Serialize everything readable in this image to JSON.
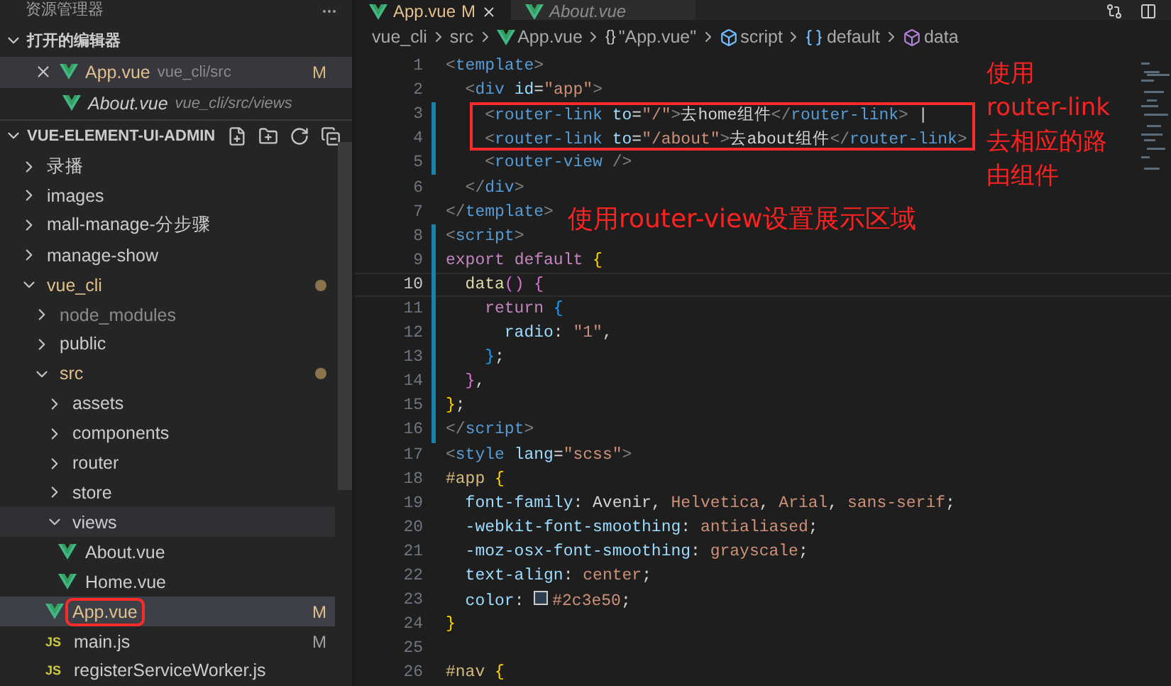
{
  "sidebar": {
    "title": "资源管理器",
    "open_editors": {
      "title": "打开的编辑器",
      "items": [
        {
          "label": "App.vue",
          "path": "vue_cli/src",
          "status": "M",
          "selected": true,
          "preview": false
        },
        {
          "label": "About.vue",
          "path": "vue_cli/src/views",
          "selected": false,
          "preview": true
        }
      ]
    },
    "project": {
      "title": "VUE-ELEMENT-UI-ADMIN",
      "tree": [
        {
          "label": "录播",
          "kind": "folder",
          "expanded": false,
          "selected": false,
          "modified": false
        },
        {
          "label": "images",
          "kind": "folder",
          "expanded": false,
          "selected": false,
          "modified": false
        },
        {
          "label": "mall-manage-分步骤",
          "kind": "folder",
          "expanded": false,
          "selected": false,
          "modified": false
        },
        {
          "label": "manage-show",
          "kind": "folder",
          "expanded": false,
          "selected": false,
          "modified": false
        },
        {
          "label": "vue_cli",
          "kind": "folder",
          "expanded": true,
          "selected": false,
          "modified": true,
          "children": [
            {
              "label": "node_modules",
              "kind": "folder",
              "expanded": false,
              "selected": false,
              "modified": false,
              "ignored": true
            },
            {
              "label": "public",
              "kind": "folder",
              "expanded": false,
              "selected": false,
              "modified": false
            },
            {
              "label": "src",
              "kind": "folder",
              "expanded": true,
              "selected": false,
              "modified": true,
              "children": [
                {
                  "label": "assets",
                  "kind": "folder",
                  "expanded": false,
                  "selected": false,
                  "modified": false
                },
                {
                  "label": "components",
                  "kind": "folder",
                  "expanded": false,
                  "selected": false,
                  "modified": false
                },
                {
                  "label": "router",
                  "kind": "folder",
                  "expanded": false,
                  "selected": false,
                  "modified": false
                },
                {
                  "label": "store",
                  "kind": "folder",
                  "expanded": false,
                  "selected": false,
                  "modified": false
                },
                {
                  "label": "views",
                  "kind": "folder",
                  "expanded": true,
                  "selected": false,
                  "modified": false,
                  "hovered": true,
                  "children": [
                    {
                      "label": "About.vue",
                      "kind": "vue",
                      "selected": false,
                      "modified": false
                    },
                    {
                      "label": "Home.vue",
                      "kind": "vue",
                      "selected": false,
                      "modified": false
                    }
                  ]
                },
                {
                  "label": "App.vue",
                  "kind": "vue",
                  "selected": true,
                  "modified": true,
                  "status": "M",
                  "annotated": true
                },
                {
                  "label": "main.js",
                  "kind": "js",
                  "badge": "JS",
                  "selected": false,
                  "modified": false,
                  "status": "M"
                },
                {
                  "label": "registerServiceWorker.js",
                  "kind": "js",
                  "badge": "JS",
                  "selected": false,
                  "modified": false
                }
              ]
            }
          ]
        }
      ]
    }
  },
  "editor": {
    "tabs": [
      {
        "label": "App.vue",
        "status": "M",
        "selected": true,
        "preview": false
      },
      {
        "label": "About.vue",
        "selected": false,
        "preview": true
      }
    ],
    "breadcrumb": [
      {
        "text": "vue_cli",
        "kind": "folder"
      },
      {
        "text": "src",
        "kind": "folder"
      },
      {
        "text": "App.vue",
        "kind": "vue"
      },
      {
        "text": "\"App.vue\"",
        "kind": "object",
        "symbol": "{}"
      },
      {
        "text": "script",
        "kind": "module"
      },
      {
        "text": "default",
        "kind": "variable"
      },
      {
        "text": "data",
        "kind": "method"
      }
    ],
    "lines": [
      {
        "number": "1",
        "changed": false,
        "current": false,
        "tokens": [
          {
            "text": "<",
            "kind": "punct"
          },
          {
            "text": "template",
            "kind": "tag"
          },
          {
            "text": ">",
            "kind": "punct"
          }
        ]
      },
      {
        "number": "2",
        "changed": false,
        "current": false,
        "tokens": [
          {
            "text": "  <",
            "kind": "punct"
          },
          {
            "text": "div",
            "kind": "tag"
          },
          {
            "text": " id",
            "kind": "attr"
          },
          {
            "text": "=",
            "kind": "plain"
          },
          {
            "text": "\"app\"",
            "kind": "string"
          },
          {
            "text": ">",
            "kind": "punct"
          }
        ]
      },
      {
        "number": "3",
        "changed": true,
        "current": false,
        "boxed": true,
        "tokens": [
          {
            "text": "    <",
            "kind": "punct"
          },
          {
            "text": "router-link",
            "kind": "tag"
          },
          {
            "text": " to",
            "kind": "attr"
          },
          {
            "text": "=",
            "kind": "plain"
          },
          {
            "text": "\"/\"",
            "kind": "string"
          },
          {
            "text": ">",
            "kind": "punct"
          },
          {
            "text": "去home组件",
            "kind": "plain"
          },
          {
            "text": "</",
            "kind": "punct"
          },
          {
            "text": "router-link",
            "kind": "tag"
          },
          {
            "text": ">",
            "kind": "punct"
          },
          {
            "text": " |",
            "kind": "plain"
          }
        ]
      },
      {
        "number": "4",
        "changed": true,
        "current": false,
        "boxed": true,
        "tokens": [
          {
            "text": "    <",
            "kind": "punct"
          },
          {
            "text": "router-link",
            "kind": "tag"
          },
          {
            "text": " to",
            "kind": "attr"
          },
          {
            "text": "=",
            "kind": "plain"
          },
          {
            "text": "\"/about\"",
            "kind": "string"
          },
          {
            "text": ">",
            "kind": "punct"
          },
          {
            "text": "去about组件",
            "kind": "plain"
          },
          {
            "text": "</",
            "kind": "punct"
          },
          {
            "text": "router-link",
            "kind": "tag"
          },
          {
            "text": ">",
            "kind": "punct"
          }
        ]
      },
      {
        "number": "5",
        "changed": true,
        "current": false,
        "tokens": [
          {
            "text": "    <",
            "kind": "punct"
          },
          {
            "text": "router-view",
            "kind": "tag"
          },
          {
            "text": " />",
            "kind": "punct"
          }
        ]
      },
      {
        "number": "6",
        "changed": false,
        "current": false,
        "tokens": [
          {
            "text": "  </",
            "kind": "punct"
          },
          {
            "text": "div",
            "kind": "tag"
          },
          {
            "text": ">",
            "kind": "punct"
          }
        ]
      },
      {
        "number": "7",
        "changed": false,
        "current": false,
        "tokens": [
          {
            "text": "</",
            "kind": "punct"
          },
          {
            "text": "template",
            "kind": "tag"
          },
          {
            "text": ">",
            "kind": "punct"
          }
        ]
      },
      {
        "number": "8",
        "changed": true,
        "current": false,
        "tokens": [
          {
            "text": "<",
            "kind": "punct"
          },
          {
            "text": "script",
            "kind": "tag"
          },
          {
            "text": ">",
            "kind": "punct"
          }
        ]
      },
      {
        "number": "9",
        "changed": true,
        "current": false,
        "tokens": [
          {
            "text": "export",
            "kind": "keyword"
          },
          {
            "text": " default",
            "kind": "keyword"
          },
          {
            "text": " {",
            "kind": "brace1"
          }
        ]
      },
      {
        "number": "10",
        "changed": true,
        "current": true,
        "tokens": [
          {
            "text": "  data",
            "kind": "func"
          },
          {
            "text": "()",
            "kind": "brace2"
          },
          {
            "text": " {",
            "kind": "brace2"
          }
        ]
      },
      {
        "number": "11",
        "changed": true,
        "current": false,
        "tokens": [
          {
            "text": "    return",
            "kind": "keyword"
          },
          {
            "text": " {",
            "kind": "brace3"
          }
        ]
      },
      {
        "number": "12",
        "changed": true,
        "current": false,
        "tokens": [
          {
            "text": "      radio",
            "kind": "attr"
          },
          {
            "text": ": ",
            "kind": "plain"
          },
          {
            "text": "\"1\"",
            "kind": "string"
          },
          {
            "text": ",",
            "kind": "plain"
          }
        ]
      },
      {
        "number": "13",
        "changed": true,
        "current": false,
        "tokens": [
          {
            "text": "    }",
            "kind": "brace3"
          },
          {
            "text": ";",
            "kind": "plain"
          }
        ]
      },
      {
        "number": "14",
        "changed": true,
        "current": false,
        "tokens": [
          {
            "text": "  }",
            "kind": "brace2"
          },
          {
            "text": ",",
            "kind": "plain"
          }
        ]
      },
      {
        "number": "15",
        "changed": true,
        "current": false,
        "tokens": [
          {
            "text": "}",
            "kind": "brace1"
          },
          {
            "text": ";",
            "kind": "plain"
          }
        ]
      },
      {
        "number": "16",
        "changed": true,
        "current": false,
        "tokens": [
          {
            "text": "</",
            "kind": "punct"
          },
          {
            "text": "script",
            "kind": "tag"
          },
          {
            "text": ">",
            "kind": "punct"
          }
        ]
      },
      {
        "number": "17",
        "changed": false,
        "current": false,
        "tokens": [
          {
            "text": "<",
            "kind": "punct"
          },
          {
            "text": "style",
            "kind": "tag"
          },
          {
            "text": " lang",
            "kind": "attr"
          },
          {
            "text": "=",
            "kind": "plain"
          },
          {
            "text": "\"scss\"",
            "kind": "string"
          },
          {
            "text": ">",
            "kind": "punct"
          }
        ]
      },
      {
        "number": "18",
        "changed": false,
        "current": false,
        "tokens": [
          {
            "text": "#app",
            "kind": "selector"
          },
          {
            "text": " {",
            "kind": "brace1"
          }
        ]
      },
      {
        "number": "19",
        "changed": false,
        "current": false,
        "tokens": [
          {
            "text": "  font-family",
            "kind": "attr"
          },
          {
            "text": ": Avenir, ",
            "kind": "plain"
          },
          {
            "text": "Helvetica",
            "kind": "string"
          },
          {
            "text": ", ",
            "kind": "plain"
          },
          {
            "text": "Arial",
            "kind": "string"
          },
          {
            "text": ", ",
            "kind": "plain"
          },
          {
            "text": "sans-serif",
            "kind": "string"
          },
          {
            "text": ";",
            "kind": "plain"
          }
        ]
      },
      {
        "number": "20",
        "changed": false,
        "current": false,
        "tokens": [
          {
            "text": "  -webkit-font-smoothing",
            "kind": "attr"
          },
          {
            "text": ": ",
            "kind": "plain"
          },
          {
            "text": "antialiased",
            "kind": "string"
          },
          {
            "text": ";",
            "kind": "plain"
          }
        ]
      },
      {
        "number": "21",
        "changed": false,
        "current": false,
        "tokens": [
          {
            "text": "  -moz-osx-font-smoothing",
            "kind": "attr"
          },
          {
            "text": ": ",
            "kind": "plain"
          },
          {
            "text": "grayscale",
            "kind": "string"
          },
          {
            "text": ";",
            "kind": "plain"
          }
        ]
      },
      {
        "number": "22",
        "changed": false,
        "current": false,
        "tokens": [
          {
            "text": "  text-align",
            "kind": "attr"
          },
          {
            "text": ": ",
            "kind": "plain"
          },
          {
            "text": "center",
            "kind": "string"
          },
          {
            "text": ";",
            "kind": "plain"
          }
        ]
      },
      {
        "number": "23",
        "changed": false,
        "current": false,
        "tokens": [
          {
            "text": "  color",
            "kind": "attr"
          },
          {
            "text": ": ",
            "kind": "plain"
          },
          {
            "text": "#2c3e50",
            "kind": "swatch"
          },
          {
            "text": ";",
            "kind": "plain"
          }
        ]
      },
      {
        "number": "24",
        "changed": false,
        "current": false,
        "tokens": [
          {
            "text": "}",
            "kind": "brace1"
          }
        ]
      },
      {
        "number": "25",
        "changed": false,
        "current": false
      },
      {
        "number": "26",
        "changed": false,
        "current": false,
        "tokens": [
          {
            "text": "#nav",
            "kind": "selector"
          },
          {
            "text": " {",
            "kind": "brace1"
          }
        ]
      }
    ],
    "annotations": [
      {
        "lines": [
          "使用",
          "router-link",
          "去相应的路",
          "由组件"
        ],
        "kind": "side"
      },
      {
        "text": "使用router-view设置展示区域",
        "kind": "inline"
      }
    ]
  }
}
